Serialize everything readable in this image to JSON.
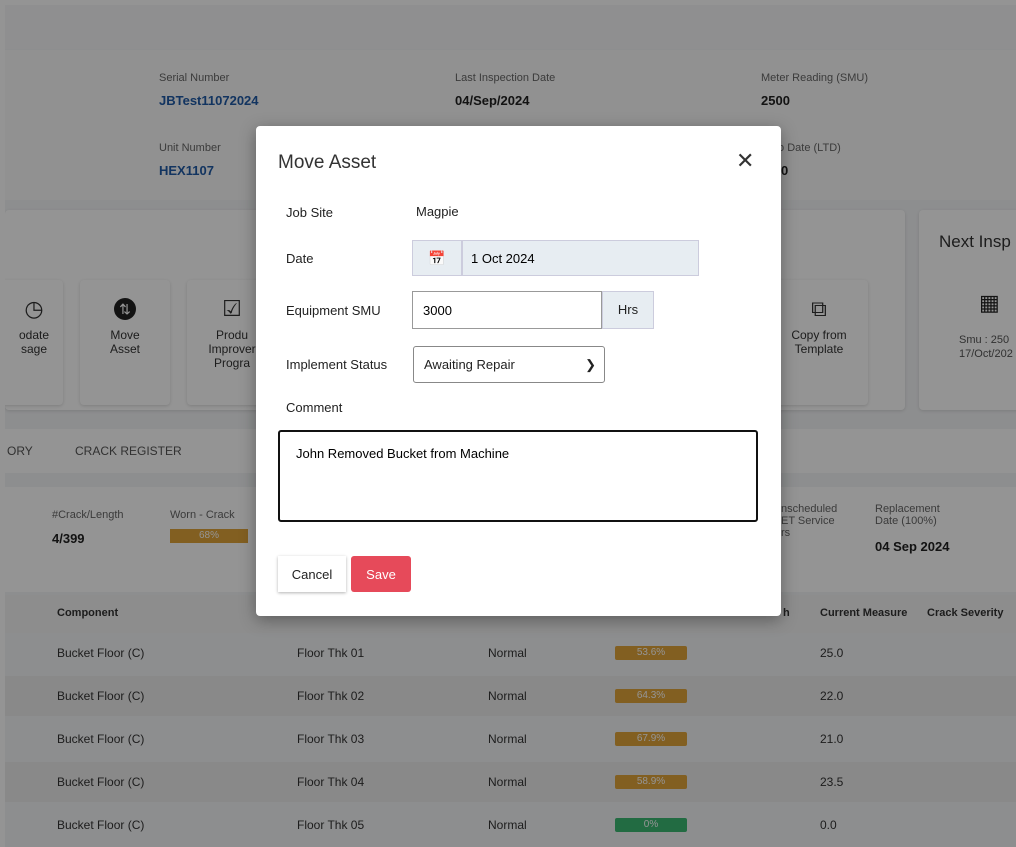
{
  "info": {
    "serial_label": "Serial Number",
    "serial_value": "JBTest11072024",
    "unit_label": "Unit Number",
    "unit_value": "HEX1107",
    "last_insp_label": "Last Inspection Date",
    "last_insp_value": "04/Sep/2024",
    "meter_label": "Meter Reading (SMU)",
    "meter_value": "2500",
    "ltd_label": "to Date (LTD)",
    "ltd_value": "0"
  },
  "next_insp": {
    "title": "Next Insp",
    "line1": "Smu : 250",
    "line2": "17/Oct/202"
  },
  "tiles": {
    "update": "odate\nsage",
    "move": "Move\nAsset",
    "product": "Produ\nImprover\nProgra",
    "copy": "Copy from\nTemplate"
  },
  "tabs": [
    "ORY",
    "CRACK REGISTER"
  ],
  "summary": {
    "crack_label": "#Crack/Length",
    "crack_value": "4/399",
    "worn_label": "Worn - Crack",
    "worn_value": "68%",
    "unscheduled_label": "nscheduled\nET Service\nrs",
    "replacement_label": "Replacement\nDate (100%)",
    "replacement_value": "04 Sep 2024"
  },
  "table": {
    "headers": {
      "component": "Component",
      "length": "h",
      "current": "Current Measure",
      "severity": "Crack Severity"
    },
    "rows": [
      {
        "component": "Bucket Floor (C)",
        "location": "Floor Thk 01",
        "status": "Normal",
        "pct": "53.6%",
        "measure": "25.0",
        "color": "#e0a43a"
      },
      {
        "component": "Bucket Floor (C)",
        "location": "Floor Thk 02",
        "status": "Normal",
        "pct": "64.3%",
        "measure": "22.0",
        "color": "#e0a43a"
      },
      {
        "component": "Bucket Floor (C)",
        "location": "Floor Thk 03",
        "status": "Normal",
        "pct": "67.9%",
        "measure": "21.0",
        "color": "#e0a43a"
      },
      {
        "component": "Bucket Floor (C)",
        "location": "Floor Thk 04",
        "status": "Normal",
        "pct": "58.9%",
        "measure": "23.5",
        "color": "#e0a43a"
      },
      {
        "component": "Bucket Floor (C)",
        "location": "Floor Thk 05",
        "status": "Normal",
        "pct": "0%",
        "measure": "0.0",
        "color": "#3bb873"
      }
    ]
  },
  "modal": {
    "title": "Move Asset",
    "job_site_label": "Job Site",
    "job_site_value": "Magpie",
    "date_label": "Date",
    "date_value": "1 Oct 2024",
    "smu_label": "Equipment SMU",
    "smu_value": "3000",
    "smu_unit": "Hrs",
    "status_label": "Implement Status",
    "status_value": "Awaiting Repair",
    "comment_label": "Comment",
    "comment_value": "John Removed Bucket from Machine",
    "cancel": "Cancel",
    "save": "Save"
  },
  "colors": {
    "save": "#e64a5a",
    "link": "#1f5aa6",
    "amber": "#e0a43a",
    "green": "#3bb873"
  },
  "icons": {
    "close": "close-icon",
    "calendar": "calendar-icon",
    "chevron": "chevron-down-icon"
  }
}
